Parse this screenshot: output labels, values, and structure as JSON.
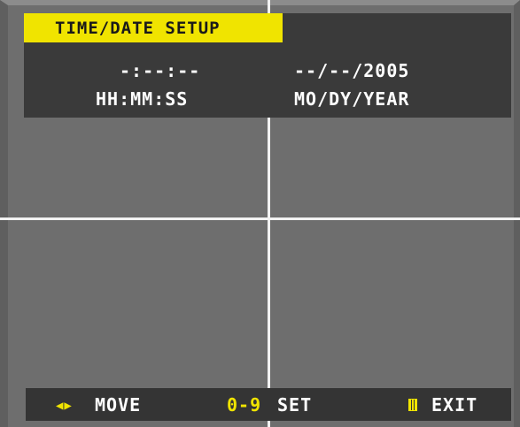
{
  "title": "TIME/DATE SETUP",
  "time": {
    "value": "-:--:--",
    "format_label": "HH:MM:SS"
  },
  "date": {
    "value": "--/--/2005",
    "format_label": "MO/DY/YEAR"
  },
  "footer": {
    "move_icon": "left-right-arrows-icon",
    "move_glyph": "◀▶",
    "move_label": "MOVE",
    "set_key": "0-9",
    "set_label": "SET",
    "exit_icon": "menu-button-icon",
    "exit_label": "EXIT"
  },
  "colors": {
    "accent": "#f0e400",
    "panel": "#3a3a3a",
    "background": "#6e6e6e",
    "text": "#ffffff"
  }
}
